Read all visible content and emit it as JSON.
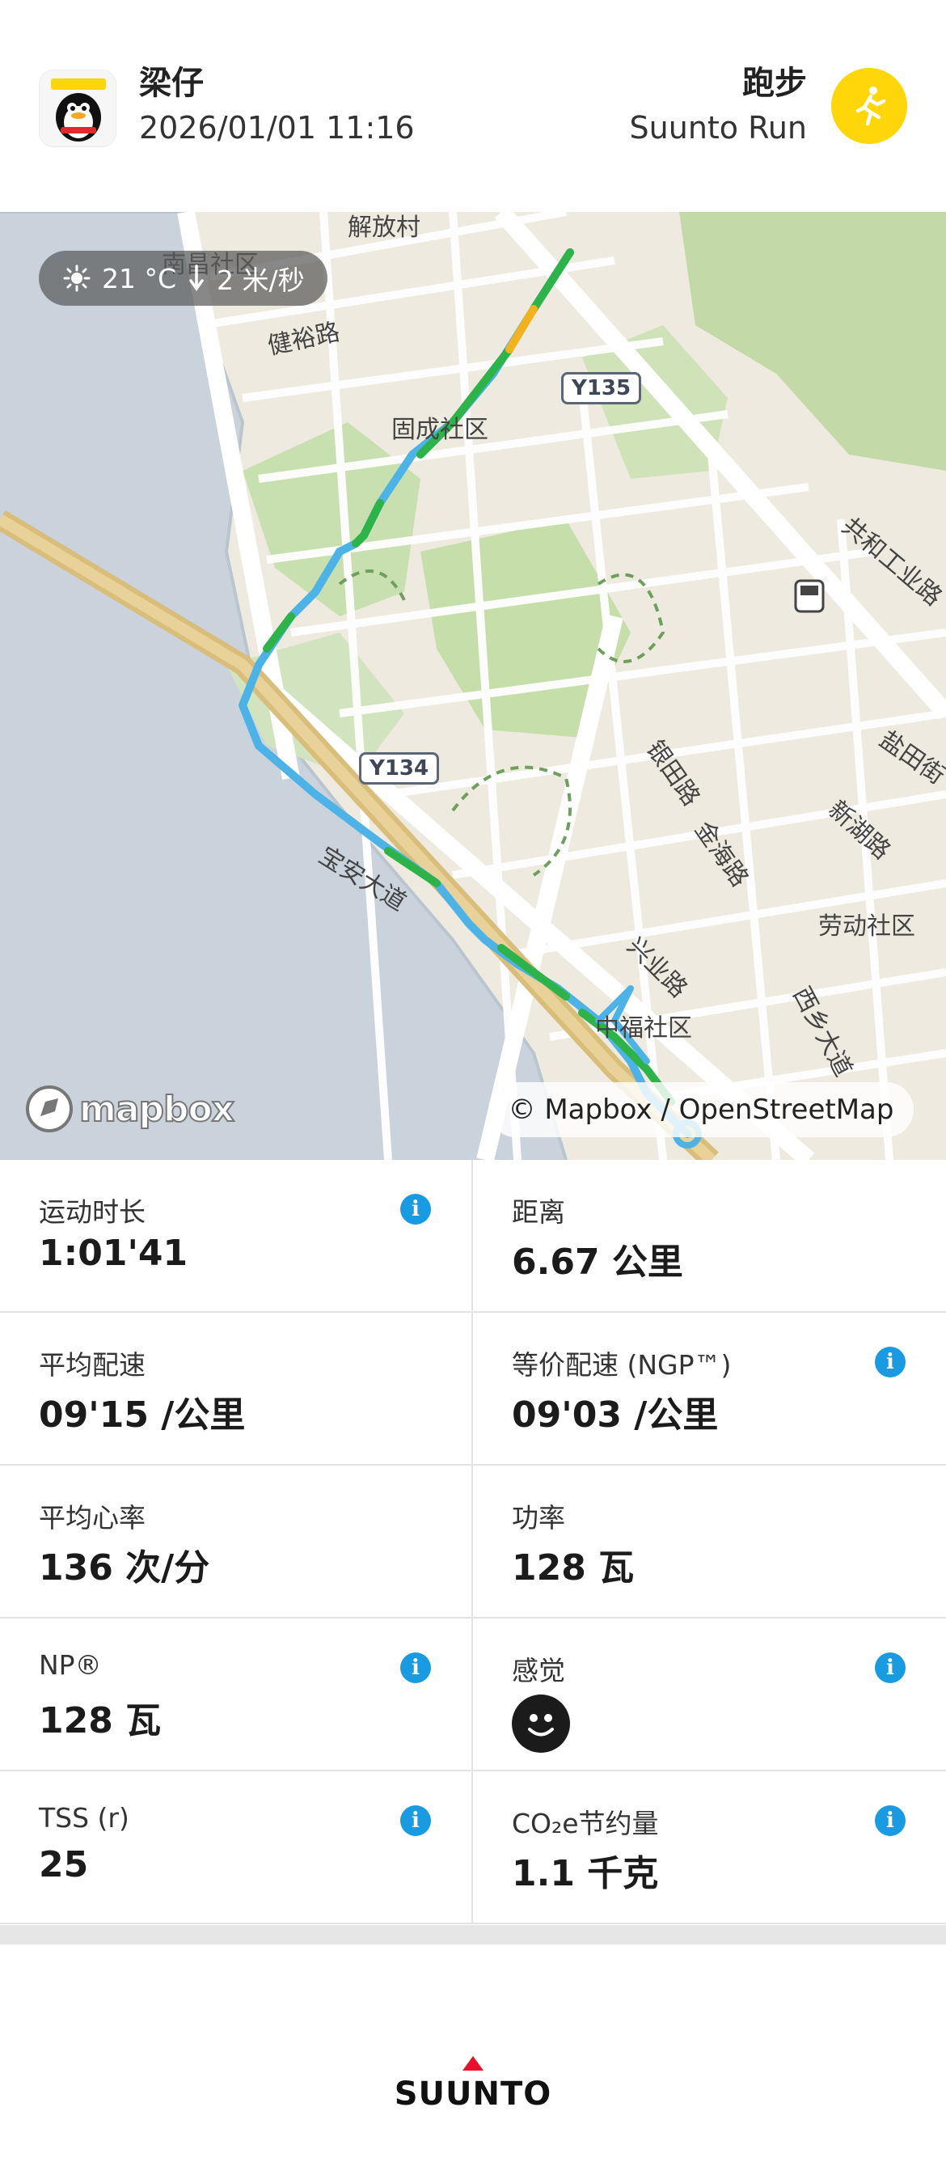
{
  "header": {
    "user_name": "梁仔",
    "date_time": "2026/01/01 11:16",
    "sport": "跑步",
    "sport_mode": "Suunto Run"
  },
  "map": {
    "weather": {
      "temperature": "21 °C",
      "wind": "2 米/秒"
    },
    "attribution": "© Mapbox / OpenStreetMap",
    "logo": "mapbox",
    "labels": {
      "nanchang": "南昌社区",
      "jianyu": "健裕路",
      "gucheng": "固成社区",
      "gonghe": "共和工业路",
      "yintian": "银田路",
      "jinhai": "金海路",
      "xinhu": "新湖路",
      "yantian": "盐田街",
      "laodong": "劳动社区",
      "xingye": "兴业路",
      "xixiang": "西乡大道",
      "zhongfu": "中福社区",
      "baoan": "宝安大道",
      "jiefang": "解放村"
    },
    "road_signs": {
      "y135": "Y135",
      "y134": "Y134"
    },
    "route_colors": {
      "fast": "#2db34a",
      "slow": "#4db3e6",
      "mid": "#f2b21e"
    }
  },
  "stats": [
    {
      "label": "运动时长",
      "value": "1:01'41",
      "info": true
    },
    {
      "label": "距离",
      "value": "6.67 公里",
      "info": false
    },
    {
      "label": "平均配速",
      "value": "09'15 /公里",
      "info": false
    },
    {
      "label": "等价配速 (NGP™)",
      "value": "09'03 /公里",
      "info": true
    },
    {
      "label": "平均心率",
      "value": "136 次/分",
      "info": false
    },
    {
      "label": "功率",
      "value": "128 瓦",
      "info": false
    },
    {
      "label": "NP®",
      "value": "128 瓦",
      "info": true
    },
    {
      "label": "感觉",
      "value": "",
      "info": true
    },
    {
      "label": "TSS (r)",
      "value": "25",
      "info": true
    },
    {
      "label": "CO₂e节约量",
      "value": "1.1 千克",
      "info": true
    }
  ],
  "info_glyph": "i",
  "footer": {
    "brand": "SUUNTO"
  },
  "colors": {
    "accent_yellow": "#ffd60a",
    "info_blue": "#1a9be1",
    "brand_red": "#e8112d"
  }
}
